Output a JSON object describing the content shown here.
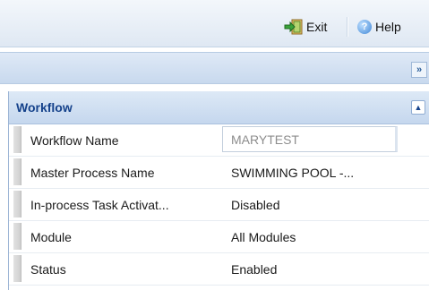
{
  "toolbar": {
    "exit_label": "Exit",
    "exit_icon": "exit-door-icon",
    "help_label": "Help",
    "help_icon": "help-icon"
  },
  "band": {
    "expand_icon": "double-chevron-right-icon",
    "expand_glyph": "»"
  },
  "panel": {
    "title": "Workflow",
    "collapse_icon": "collapse-up-icon",
    "collapse_glyph": "▲",
    "rows": [
      {
        "label": "Workflow Name",
        "value": "MARYTEST",
        "editable": true
      },
      {
        "label": "Master Process Name",
        "value": "SWIMMING POOL -..."
      },
      {
        "label": "In-process Task Activat...",
        "value": "Disabled"
      },
      {
        "label": "Module",
        "value": "All Modules"
      },
      {
        "label": "Status",
        "value": "Enabled"
      }
    ]
  },
  "colors": {
    "header_text": "#15428b",
    "band": "#c8d9ee",
    "text": "#1a1a1a",
    "input_text": "#8d8d8d"
  }
}
